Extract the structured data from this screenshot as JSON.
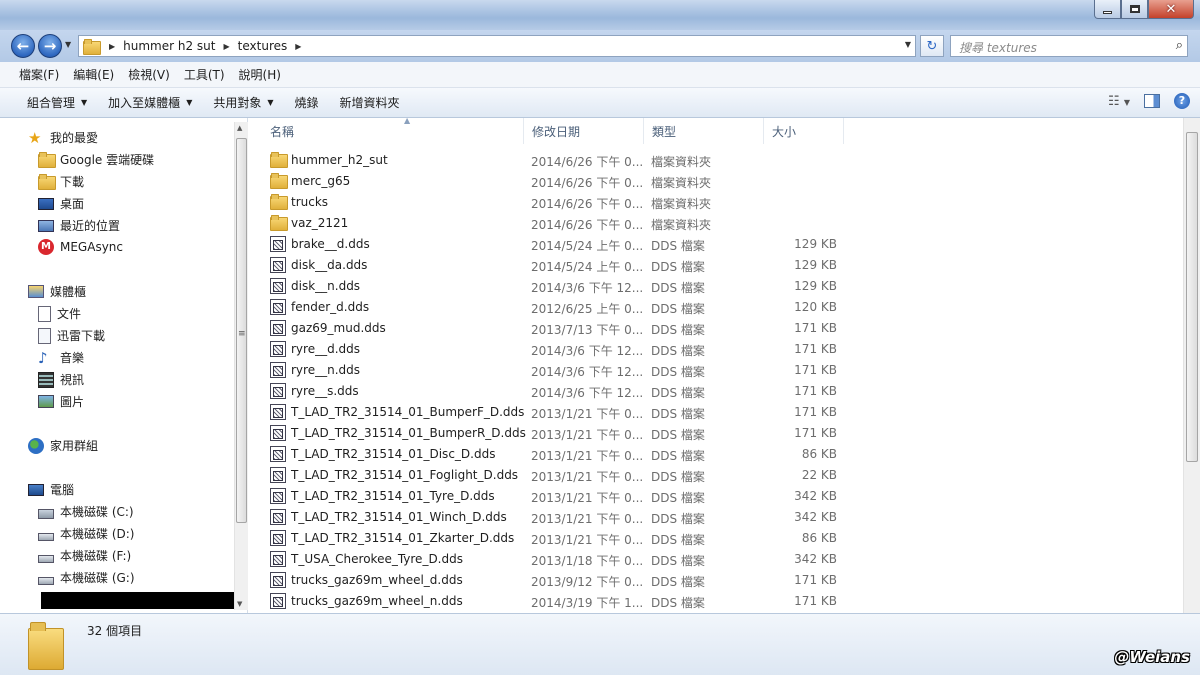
{
  "address": {
    "crumbs": [
      "hummer h2 sut",
      "textures"
    ],
    "search_placeholder": "搜尋 textures"
  },
  "menu": [
    "檔案(F)",
    "編輯(E)",
    "檢視(V)",
    "工具(T)",
    "說明(H)"
  ],
  "commands": {
    "organize": "組合管理",
    "add_to_library": "加入至媒體櫃",
    "share": "共用對象",
    "burn": "燒錄",
    "new_folder": "新增資料夾"
  },
  "nav": {
    "favorites": "我的最愛",
    "google_drive": "Google 雲端硬碟",
    "downloads": "下載",
    "desktop": "桌面",
    "recent": "最近的位置",
    "megasync": "MEGAsync",
    "libraries": "媒體櫃",
    "documents": "文件",
    "thunder": "迅雷下載",
    "music": "音樂",
    "videos": "視訊",
    "pictures": "圖片",
    "homegroup": "家用群組",
    "computer": "電腦",
    "drive_c": "本機磁碟 (C:)",
    "drive_d": "本機磁碟 (D:)",
    "drive_f": "本機磁碟 (F:)",
    "drive_g": "本機磁碟 (G:)"
  },
  "columns": {
    "name": "名稱",
    "date": "修改日期",
    "type": "類型",
    "size": "大小"
  },
  "files": [
    {
      "name": "hummer_h2_sut",
      "date": "2014/6/26 下午 0...",
      "type": "檔案資料夾",
      "size": "",
      "kind": "folder"
    },
    {
      "name": "merc_g65",
      "date": "2014/6/26 下午 0...",
      "type": "檔案資料夾",
      "size": "",
      "kind": "folder"
    },
    {
      "name": "trucks",
      "date": "2014/6/26 下午 0...",
      "type": "檔案資料夾",
      "size": "",
      "kind": "folder"
    },
    {
      "name": "vaz_2121",
      "date": "2014/6/26 下午 0...",
      "type": "檔案資料夾",
      "size": "",
      "kind": "folder"
    },
    {
      "name": "brake__d.dds",
      "date": "2014/5/24 上午 0...",
      "type": "DDS 檔案",
      "size": "129 KB",
      "kind": "dds"
    },
    {
      "name": "disk__da.dds",
      "date": "2014/5/24 上午 0...",
      "type": "DDS 檔案",
      "size": "129 KB",
      "kind": "dds"
    },
    {
      "name": "disk__n.dds",
      "date": "2014/3/6 下午 12...",
      "type": "DDS 檔案",
      "size": "129 KB",
      "kind": "dds"
    },
    {
      "name": "fender_d.dds",
      "date": "2012/6/25 上午 0...",
      "type": "DDS 檔案",
      "size": "120 KB",
      "kind": "dds"
    },
    {
      "name": "gaz69_mud.dds",
      "date": "2013/7/13 下午 0...",
      "type": "DDS 檔案",
      "size": "171 KB",
      "kind": "dds"
    },
    {
      "name": "ryre__d.dds",
      "date": "2014/3/6 下午 12...",
      "type": "DDS 檔案",
      "size": "171 KB",
      "kind": "dds"
    },
    {
      "name": "ryre__n.dds",
      "date": "2014/3/6 下午 12...",
      "type": "DDS 檔案",
      "size": "171 KB",
      "kind": "dds"
    },
    {
      "name": "ryre__s.dds",
      "date": "2014/3/6 下午 12...",
      "type": "DDS 檔案",
      "size": "171 KB",
      "kind": "dds"
    },
    {
      "name": "T_LAD_TR2_31514_01_BumperF_D.dds",
      "date": "2013/1/21 下午 0...",
      "type": "DDS 檔案",
      "size": "171 KB",
      "kind": "dds"
    },
    {
      "name": "T_LAD_TR2_31514_01_BumperR_D.dds",
      "date": "2013/1/21 下午 0...",
      "type": "DDS 檔案",
      "size": "171 KB",
      "kind": "dds"
    },
    {
      "name": "T_LAD_TR2_31514_01_Disc_D.dds",
      "date": "2013/1/21 下午 0...",
      "type": "DDS 檔案",
      "size": "86 KB",
      "kind": "dds"
    },
    {
      "name": "T_LAD_TR2_31514_01_Foglight_D.dds",
      "date": "2013/1/21 下午 0...",
      "type": "DDS 檔案",
      "size": "22 KB",
      "kind": "dds"
    },
    {
      "name": "T_LAD_TR2_31514_01_Tyre_D.dds",
      "date": "2013/1/21 下午 0...",
      "type": "DDS 檔案",
      "size": "342 KB",
      "kind": "dds"
    },
    {
      "name": "T_LAD_TR2_31514_01_Winch_D.dds",
      "date": "2013/1/21 下午 0...",
      "type": "DDS 檔案",
      "size": "342 KB",
      "kind": "dds"
    },
    {
      "name": "T_LAD_TR2_31514_01_Zkarter_D.dds",
      "date": "2013/1/21 下午 0...",
      "type": "DDS 檔案",
      "size": "86 KB",
      "kind": "dds"
    },
    {
      "name": "T_USA_Cherokee_Tyre_D.dds",
      "date": "2013/1/18 下午 0...",
      "type": "DDS 檔案",
      "size": "342 KB",
      "kind": "dds"
    },
    {
      "name": "trucks_gaz69m_wheel_d.dds",
      "date": "2013/9/12 下午 0...",
      "type": "DDS 檔案",
      "size": "171 KB",
      "kind": "dds"
    },
    {
      "name": "trucks_gaz69m_wheel_n.dds",
      "date": "2014/3/19 下午 1...",
      "type": "DDS 檔案",
      "size": "171 KB",
      "kind": "dds"
    }
  ],
  "status": {
    "item_count": "32 個項目"
  },
  "watermark": "@Weians"
}
